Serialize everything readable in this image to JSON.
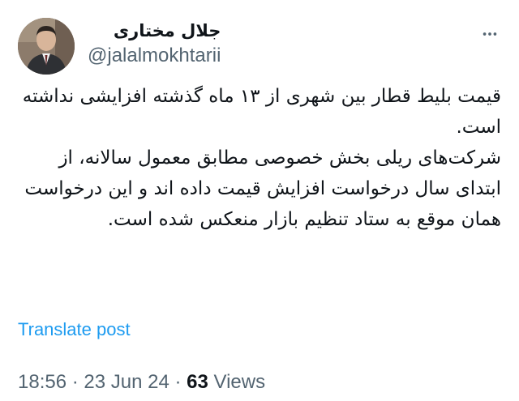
{
  "author": {
    "display_name": "جلال مختاری",
    "handle": "@jalalmokhtarii"
  },
  "icons": {
    "more": "more-horizontal-icon",
    "avatar": "profile-photo"
  },
  "tweet": {
    "paragraph_1": "قیمت بلیط قطار بین شهری از ۱۳ ماه گذشته افزایشی نداشته است.",
    "paragraph_2": "شرکت‌های ریلی بخش خصوصی مطابق معمول سالانه، از ابتدای سال درخواست افزایش قیمت داده اند و این درخواست همان موقع به ستاد تنظیم بازار منعکس شده است."
  },
  "translate_label": "Translate post",
  "meta": {
    "time": "18:56",
    "separator_1": " · ",
    "date": "23 Jun 24",
    "separator_2": " · ",
    "views_count": "63",
    "views_label": " Views"
  },
  "colors": {
    "text": "#0f1419",
    "secondary": "#536471",
    "link": "#1d9bf0",
    "background": "#ffffff"
  }
}
